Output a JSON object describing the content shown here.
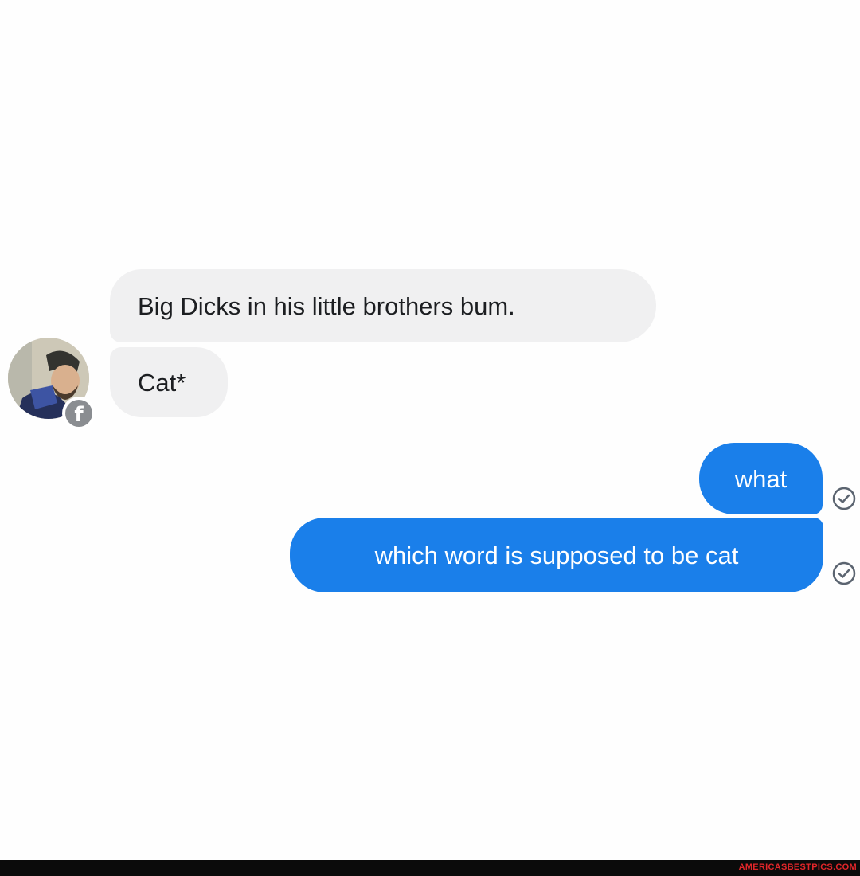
{
  "conversation": {
    "incoming": [
      {
        "text": "Big Dicks in his little brothers bum."
      },
      {
        "text": "Cat*"
      }
    ],
    "outgoing": [
      {
        "text": "what",
        "status": "sent"
      },
      {
        "text": "which word is supposed to be cat",
        "status": "sent"
      }
    ],
    "contact": {
      "avatar_icon": "user-avatar",
      "badge_icon": "facebook-icon"
    },
    "status_icon": "check-circle-icon"
  },
  "footer": {
    "watermark": "AMERICASBESTPICS.COM"
  },
  "colors": {
    "outgoing_bubble": "#1a7fea",
    "incoming_bubble": "#f0f0f1",
    "incoming_text": "#1c1e21",
    "watermark": "#e2262a",
    "footer_bar": "#0b0b0b"
  }
}
